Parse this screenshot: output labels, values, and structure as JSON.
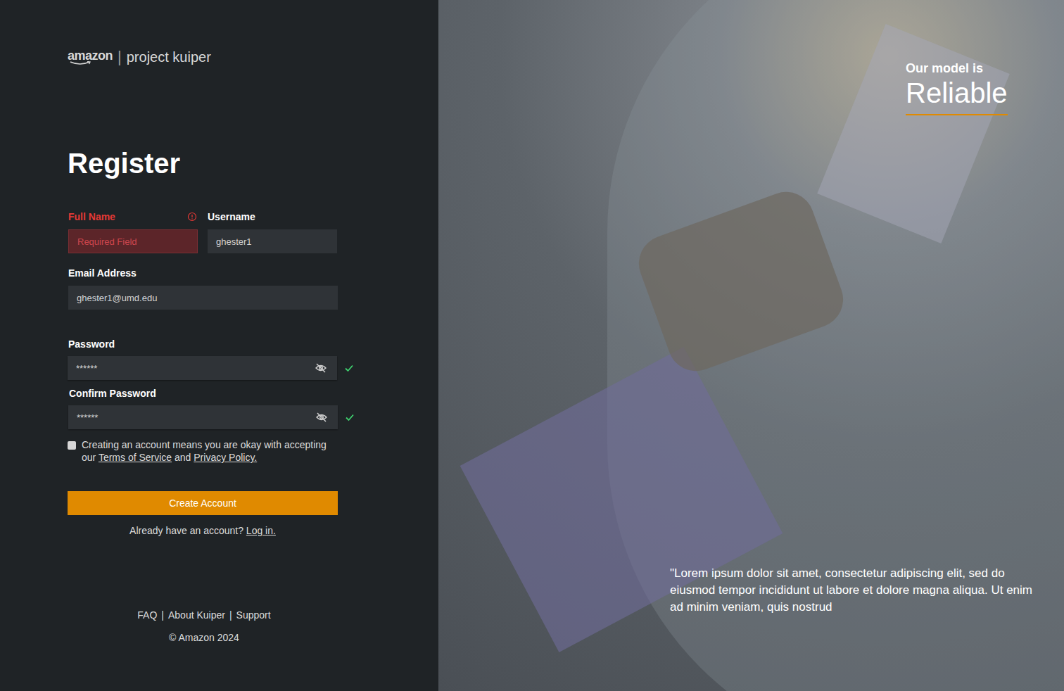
{
  "logo": {
    "brand": "amazon",
    "divider": "|",
    "product": "project kuiper"
  },
  "heading": "Register",
  "fields": {
    "full_name": {
      "label": "Full Name",
      "placeholder": "Required Field",
      "value": "",
      "error": true
    },
    "username": {
      "label": "Username",
      "value": "ghester1"
    },
    "email": {
      "label": "Email Address",
      "value": "ghester1@umd.edu"
    },
    "password": {
      "label": "Password",
      "value": "******",
      "valid": true,
      "hidden": true
    },
    "confirm_password": {
      "label": "Confirm Password",
      "value": "******",
      "valid": true,
      "hidden": true
    }
  },
  "terms": {
    "checked": false,
    "text_before": "Creating an account means you are okay with accepting our ",
    "terms_link": "Terms of Service",
    "middle": " and ",
    "privacy_link": "Privacy Policy."
  },
  "create_button": "Create Account",
  "login": {
    "prompt": "Already have an account? ",
    "link": "Log in."
  },
  "footer": {
    "links": [
      "FAQ",
      "About Kuiper",
      "Support"
    ],
    "separator": "|",
    "copyright": "© Amazon 2024"
  },
  "hero": {
    "kicker": "Our model is",
    "headline": "Reliable",
    "quote": "\"Lorem ipsum dolor sit amet, consectetur adipiscing elit, sed do eiusmod tempor incididunt ut labore et dolore magna aliqua. Ut enim ad minim veniam, quis nostrud"
  }
}
